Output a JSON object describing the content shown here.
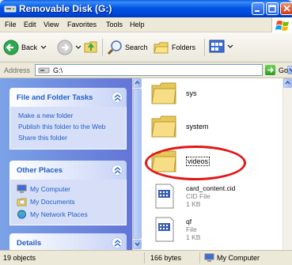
{
  "window": {
    "title": "Removable Disk (G:)"
  },
  "menubar": {
    "items": [
      "File",
      "Edit",
      "View",
      "Favorites",
      "Tools",
      "Help"
    ]
  },
  "toolbar": {
    "back": "Back",
    "search": "Search",
    "folders": "Folders"
  },
  "address": {
    "label": "Address",
    "value": "G:\\",
    "go": "Go"
  },
  "taskpane": {
    "file_tasks": {
      "title": "File and Folder Tasks",
      "links": [
        "Make a new folder",
        "Publish this folder to the Web",
        "Share this folder"
      ]
    },
    "other_places": {
      "title": "Other Places",
      "links": [
        "My Computer",
        "My Documents",
        "My Network Places"
      ]
    },
    "details": {
      "title": "Details"
    }
  },
  "files": [
    {
      "name": "sys",
      "type": "folder"
    },
    {
      "name": "system",
      "type": "folder"
    },
    {
      "name": "videos",
      "type": "folder"
    },
    {
      "name": "card_content.cid",
      "type_label": "CID File",
      "size": "1 KB"
    },
    {
      "name": "qf",
      "type_label": "File",
      "size": "1 KB"
    }
  ],
  "status": {
    "objects": "19 objects",
    "bytes": "166 bytes",
    "location": "My Computer"
  },
  "colors": {
    "title_bar": "#0055e5",
    "taskpane": "#7ba2e7",
    "link": "#215dc6",
    "highlight_ring": "#e01818"
  }
}
